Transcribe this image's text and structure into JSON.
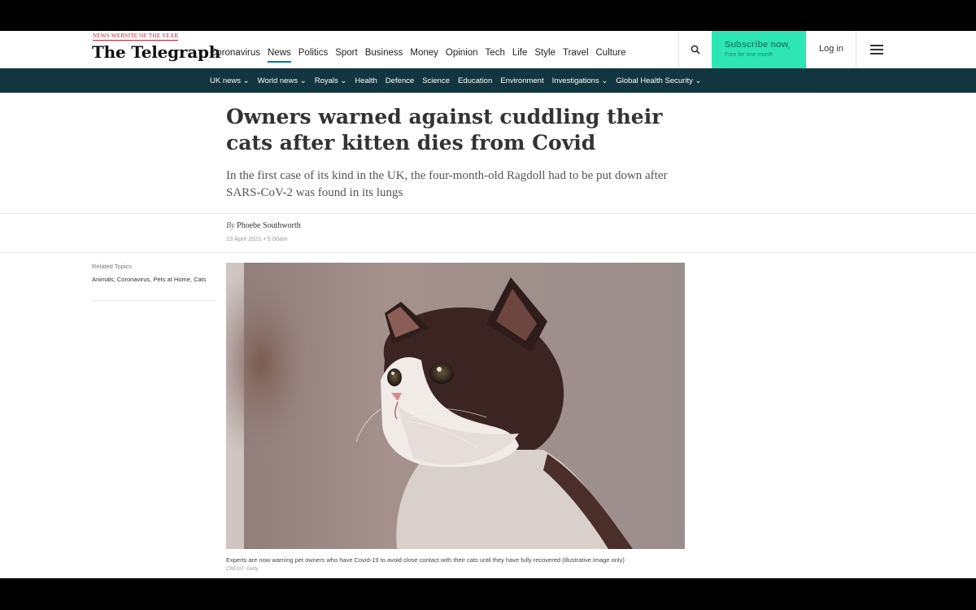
{
  "header": {
    "award_text": "NEWS WEBSITE OF THE YEAR",
    "logo_text": "The Telegraph",
    "nav_items": [
      "Coronavirus",
      "News",
      "Politics",
      "Sport",
      "Business",
      "Money",
      "Opinion",
      "Tech",
      "Life",
      "Style",
      "Travel",
      "Culture"
    ],
    "active_nav": "News",
    "subscribe_label": "Subscribe now",
    "subscribe_sub": "Free for one month",
    "login_label": "Log in",
    "icons": {
      "search": "search-icon",
      "menu": "hamburger-menu-icon"
    },
    "accent_color": "#2ee6b4"
  },
  "subnav": {
    "background": "#12363f",
    "items": [
      "UK news ⌄",
      "World news ⌄",
      "Royals ⌄",
      "Health",
      "Defence",
      "Science",
      "Education",
      "Environment",
      "Investigations ⌄",
      "Global Health Security ⌄"
    ]
  },
  "article": {
    "headline": "Owners warned against cuddling their cats after kitten dies from Covid",
    "standfirst": "In the first case of its kind in the UK, the four-month-old Ragdoll had to be put down after SARS-CoV-2 was found in its lungs",
    "byline_prefix": "By",
    "author": "Phoebe Southworth",
    "date": "23 April 2021 • 5:00am",
    "related_title": "Related Topics",
    "related_topics": [
      "Animals",
      "Coronavirus",
      "Pets at Home",
      "Cats"
    ],
    "image_caption": "Experts are now warning pet owners who have Covid-19 to avoid close contact with their cats until they have fully recovered (illustrative image only)",
    "image_credit": "CREDIT: Getty"
  }
}
